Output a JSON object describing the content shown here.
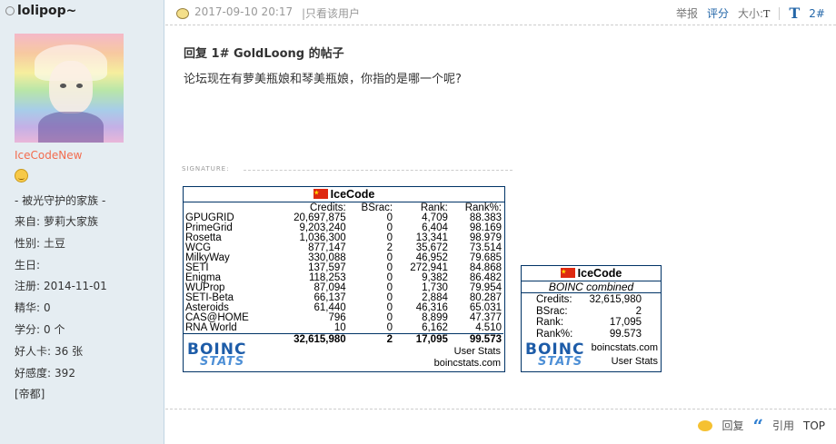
{
  "sidebar": {
    "username": "lolipop~",
    "level": "IceCodeNew",
    "motto": "- 被光守护的家族 -",
    "info": [
      {
        "label": "来自:",
        "value": "萝莉大家族"
      },
      {
        "label": "性别:",
        "value": "土豆"
      },
      {
        "label": "生日:",
        "value": ""
      },
      {
        "label": "注册:",
        "value": "2014-11-01"
      },
      {
        "label": "精华:",
        "value": "0"
      },
      {
        "label": "学分:",
        "value": "0 个"
      },
      {
        "label": "好人卡:",
        "value": "36 张"
      },
      {
        "label": "好感度:",
        "value": "392"
      },
      {
        "label": "[帝都]",
        "value": ""
      }
    ]
  },
  "post": {
    "date": "2017-09-10 20:17",
    "only_author": "|只看该用户",
    "tools": {
      "report": "举报",
      "rate": "评分",
      "size_label": "大小:",
      "size_small": "T",
      "size_big": "T",
      "floor": "2#"
    },
    "title": "回复 1# GoldLoong 的帖子",
    "message": "论坛现在有萝美瓶娘和琴美瓶娘，你指的是哪一个呢?",
    "signature_label": "SIGNATURE:"
  },
  "stats": {
    "user": "IceCode",
    "columns": [
      "",
      "Credits:",
      "BSrac:",
      "Rank:",
      "Rank%:"
    ],
    "rows": [
      [
        "GPUGRID",
        "20,697,875",
        "0",
        "4,709",
        "88.383"
      ],
      [
        "PrimeGrid",
        "9,203,240",
        "0",
        "6,404",
        "98.169"
      ],
      [
        "Rosetta",
        "1,036,300",
        "0",
        "13,341",
        "98.979"
      ],
      [
        "WCG",
        "877,147",
        "2",
        "35,672",
        "73.514"
      ],
      [
        "MilkyWay",
        "330,088",
        "0",
        "46,952",
        "79.685"
      ],
      [
        "SETI",
        "137,597",
        "0",
        "272,941",
        "84.868"
      ],
      [
        "Enigma",
        "118,253",
        "0",
        "9,382",
        "86.482"
      ],
      [
        "WUProp",
        "87,094",
        "0",
        "1,730",
        "79.954"
      ],
      [
        "SETI-Beta",
        "66,137",
        "0",
        "2,884",
        "80.287"
      ],
      [
        "Asteroids",
        "61,440",
        "0",
        "46,316",
        "65.031"
      ],
      [
        "CAS@HOME",
        "796",
        "0",
        "8,899",
        "47.377"
      ],
      [
        "RNA World",
        "10",
        "0",
        "6,162",
        "4.510"
      ]
    ],
    "total": [
      "",
      "32,615,980",
      "2",
      "17,095",
      "99.573"
    ],
    "logo_top": "BOINC",
    "logo_bottom": "STATS",
    "foot_line1": "User Stats",
    "foot_line2": "boincstats.com"
  },
  "combined": {
    "user": "IceCode",
    "subtitle": "BOINC combined",
    "rows": [
      [
        "Credits:",
        "32,615,980"
      ],
      [
        "BSrac:",
        "2"
      ],
      [
        "Rank:",
        "17,095"
      ],
      [
        "Rank%:",
        "99.573"
      ]
    ],
    "foot_line1": "boincstats.com",
    "foot_line2": "User Stats"
  },
  "actions": {
    "reply": "回复",
    "quote": "引用",
    "top": "TOP"
  }
}
